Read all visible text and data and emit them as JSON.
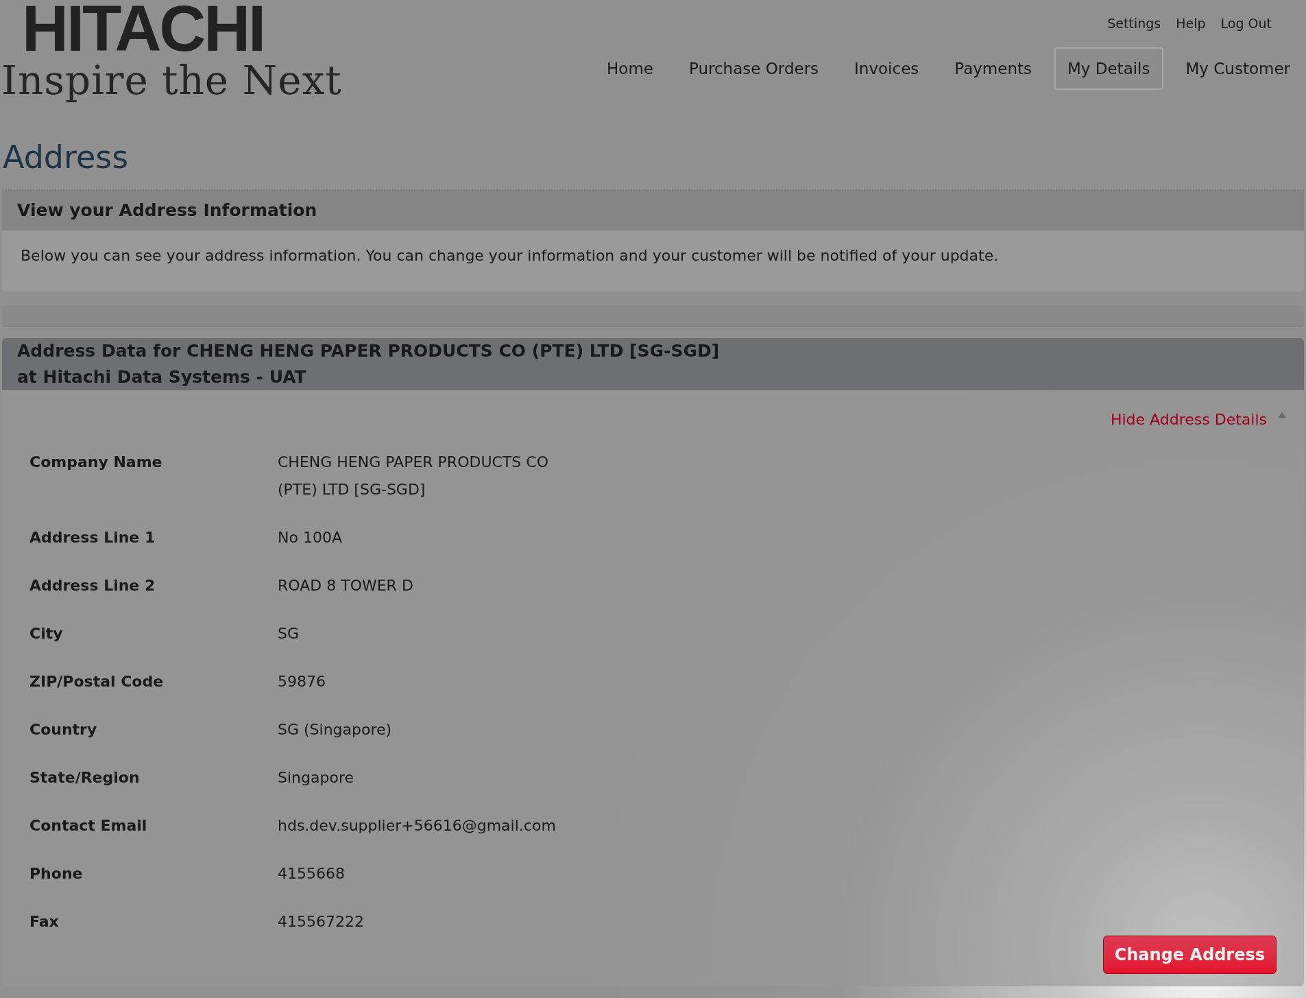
{
  "logo": {
    "name": "HITACHI",
    "tagline": "Inspire the Next"
  },
  "top_links": [
    "Settings",
    "Help",
    "Log Out"
  ],
  "nav": [
    {
      "label": "Home",
      "selected": false
    },
    {
      "label": "Purchase Orders",
      "selected": false
    },
    {
      "label": "Invoices",
      "selected": false
    },
    {
      "label": "Payments",
      "selected": false
    },
    {
      "label": "My Details",
      "selected": true
    },
    {
      "label": "My Customer",
      "selected": false
    }
  ],
  "page_title": "Address",
  "info_section": {
    "title": "View your Address Information",
    "description": "Below you can see your address information. You can change your information and your customer will be notified of your update."
  },
  "address_section": {
    "title": "Address Data for CHENG HENG PAPER PRODUCTS CO (PTE) LTD [SG-SGD] at Hitachi Data Systems - UAT",
    "toggle_link": "Hide Address Details",
    "expanded": true,
    "fields": [
      {
        "label": "Company Name",
        "value": "CHENG HENG PAPER PRODUCTS CO (PTE) LTD [SG-SGD]"
      },
      {
        "label": "Address Line 1",
        "value": "No 100A"
      },
      {
        "label": "Address Line 2",
        "value": "ROAD 8 TOWER D"
      },
      {
        "label": "City",
        "value": "SG"
      },
      {
        "label": "ZIP/Postal Code",
        "value": "59876"
      },
      {
        "label": "Country",
        "value": "SG (Singapore)"
      },
      {
        "label": "State/Region",
        "value": "Singapore"
      },
      {
        "label": "Contact Email",
        "value": "hds.dev.supplier+56616@gmail.com"
      },
      {
        "label": "Phone",
        "value": "4155668"
      },
      {
        "label": "Fax",
        "value": "415567222"
      }
    ],
    "button": "Change Address"
  }
}
